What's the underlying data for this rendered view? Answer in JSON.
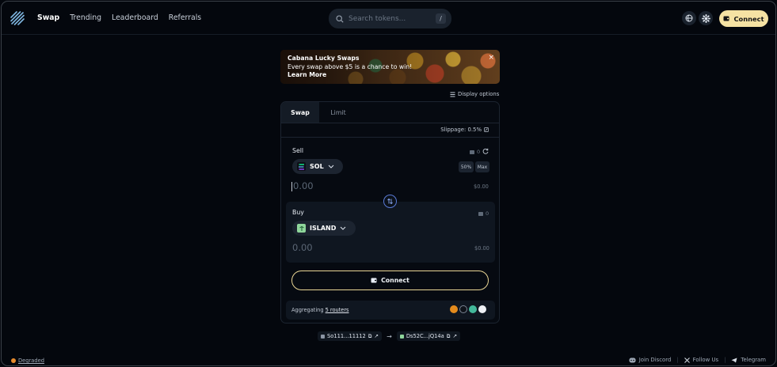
{
  "nav": {
    "items": [
      {
        "label": "Swap",
        "active": true
      },
      {
        "label": "Trending",
        "active": false
      },
      {
        "label": "Leaderboard",
        "active": false
      },
      {
        "label": "Referrals",
        "active": false
      }
    ]
  },
  "search": {
    "placeholder": "Search tokens...",
    "shortcut": "/"
  },
  "header": {
    "connect_label": "Connect",
    "icons": [
      "globe-icon",
      "gear-icon",
      "wallet-icon"
    ]
  },
  "banner": {
    "title": "Cabana Lucky Swaps",
    "text": "Every swap above $5 is a chance to win!",
    "link": "Learn More",
    "close": "×"
  },
  "display_options": "Display options",
  "swap": {
    "tabs": [
      "Swap",
      "Limit"
    ],
    "slippage": "Slippage: 0.5%",
    "sell": {
      "label": "Sell",
      "balance": "0",
      "token": "SOL",
      "half_label": "50%",
      "max_label": "Max",
      "amount_placeholder": "0.00",
      "usd": "$0.00"
    },
    "buy": {
      "label": "Buy",
      "balance": "0",
      "token": "ISLAND",
      "amount_placeholder": "0.00",
      "usd": "$0.00"
    },
    "connect_label": "Connect",
    "aggregating_prefix": "Aggregating",
    "aggregating_link": "5 routers"
  },
  "addresses": {
    "from": "So111...11112",
    "to": "Ds52C...jQ14a"
  },
  "footer": {
    "status": "Degraded",
    "discord": "Join Discord",
    "x": "Follow Us",
    "telegram": "Telegram"
  },
  "colors": {
    "accent": "#f5e2a3",
    "background": "#04070d",
    "status_degraded": "#e78b2c"
  }
}
